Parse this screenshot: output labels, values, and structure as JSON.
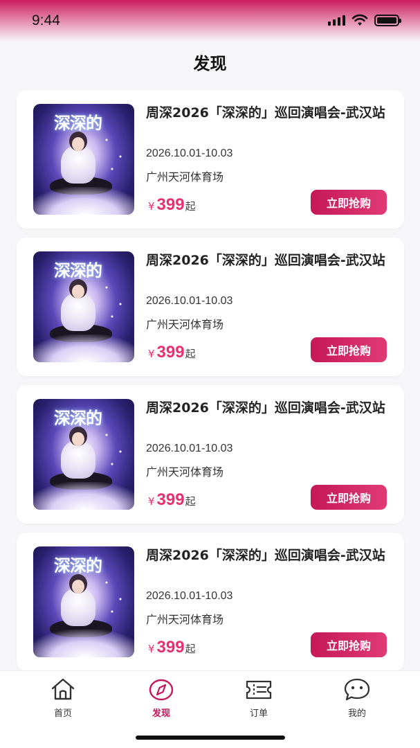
{
  "status_bar": {
    "time": "9:44"
  },
  "header": {
    "title": "发现"
  },
  "concerts": [
    {
      "title": "周深2026「深深的」巡回演唱会-武汉站",
      "date": "2026.10.01-10.03",
      "venue": "广州天河体育场",
      "currency": "¥",
      "price": "399",
      "price_suffix": "起",
      "buy_label": "立即抢购",
      "poster_title": "深深的"
    },
    {
      "title": "周深2026「深深的」巡回演唱会-武汉站",
      "date": "2026.10.01-10.03",
      "venue": "广州天河体育场",
      "currency": "¥",
      "price": "399",
      "price_suffix": "起",
      "buy_label": "立即抢购",
      "poster_title": "深深的"
    },
    {
      "title": "周深2026「深深的」巡回演唱会-武汉站",
      "date": "2026.10.01-10.03",
      "venue": "广州天河体育场",
      "currency": "¥",
      "price": "399",
      "price_suffix": "起",
      "buy_label": "立即抢购",
      "poster_title": "深深的"
    },
    {
      "title": "周深2026「深深的」巡回演唱会-武汉站",
      "date": "2026.10.01-10.03",
      "venue": "广州天河体育场",
      "currency": "¥",
      "price": "399",
      "price_suffix": "起",
      "buy_label": "立即抢购",
      "poster_title": "深深的"
    }
  ],
  "tab_bar": {
    "tabs": [
      {
        "label": "首页",
        "icon": "home-icon",
        "active": false
      },
      {
        "label": "发现",
        "icon": "compass-icon",
        "active": true
      },
      {
        "label": "订单",
        "icon": "ticket-icon",
        "active": false
      },
      {
        "label": "我的",
        "icon": "chat-face-icon",
        "active": false
      }
    ]
  },
  "colors": {
    "accent": "#c4165a",
    "price": "#e8306e",
    "status_gradient_top": "#cc1d5e"
  }
}
